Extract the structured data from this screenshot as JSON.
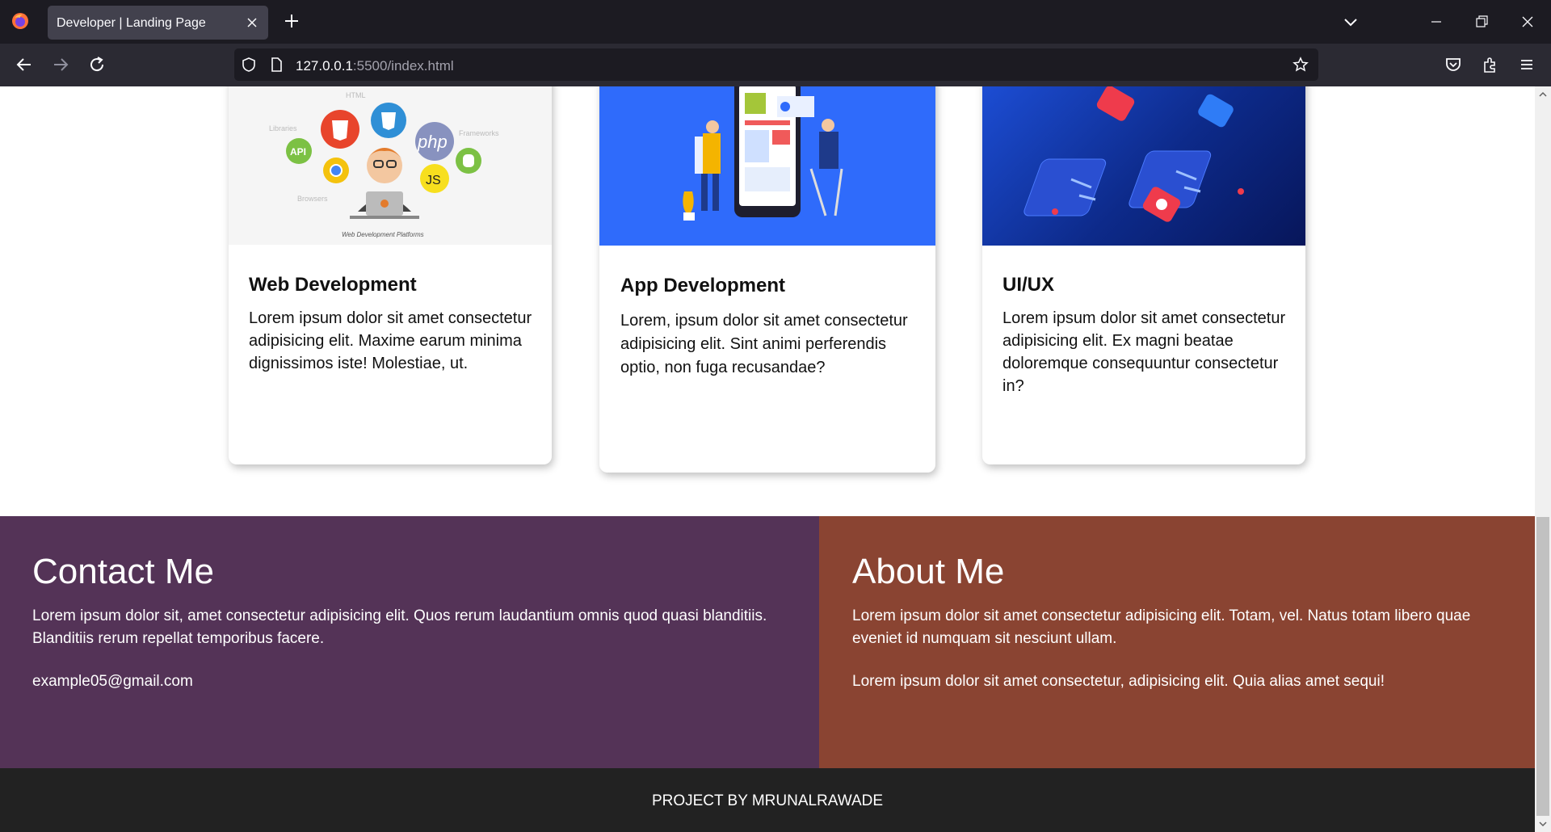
{
  "browser": {
    "tab_title": "Developer | Landing Page",
    "url_host": "127.0.0.1",
    "url_path": ":5500/index.html"
  },
  "cards": [
    {
      "title": "Web Development",
      "text": "Lorem ipsum dolor sit amet consectetur adipisicing elit. Maxime earum minima dignissimos iste! Molestiae, ut.",
      "image_labels": [
        "HTML",
        "php",
        "JS",
        "API",
        "Libraries",
        "Browsers",
        "Frameworks",
        "Web Development Platforms"
      ]
    },
    {
      "title": "App Development",
      "text": "Lorem, ipsum dolor sit amet consectetur adipisicing elit. Sint animi perferendis optio, non fuga recusandae?"
    },
    {
      "title": "UI/UX",
      "text": "Lorem ipsum dolor sit amet consectetur adipisicing elit. Ex magni beatae doloremque consequuntur consectetur in?"
    }
  ],
  "contact": {
    "title": "Contact Me",
    "text": "Lorem ipsum dolor sit, amet consectetur adipisicing elit. Quos rerum laudantium omnis quod quasi blanditiis. Blanditiis rerum repellat temporibus facere.",
    "email": "example05@gmail.com"
  },
  "about": {
    "title": "About Me",
    "text1": "Lorem ipsum dolor sit amet consectetur adipisicing elit. Totam, vel. Natus totam libero quae eveniet id numquam sit nesciunt ullam.",
    "text2": "Lorem ipsum dolor sit amet consectetur, adipisicing elit. Quia alias amet sequi!"
  },
  "footer": {
    "credit": "PROJECT BY MRUNALRAWADE"
  },
  "colors": {
    "contact_bg": "#543357",
    "about_bg": "#8a4432",
    "footer_bg": "#222222",
    "app_card_bg": "#2f6bfb"
  }
}
